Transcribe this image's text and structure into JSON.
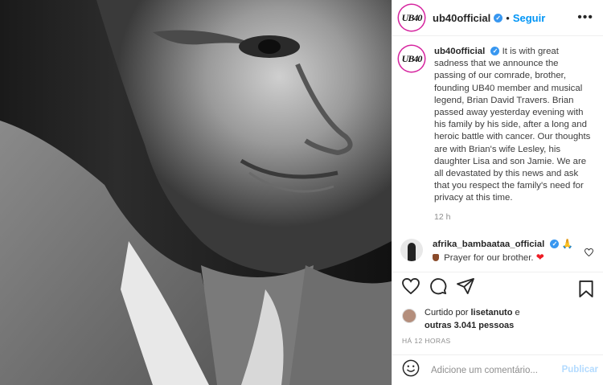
{
  "post": {
    "username": "ub40official",
    "avatar_text": "UB40",
    "follow_label": "Seguir",
    "dot": "•",
    "more_label": "•••",
    "caption": "It is with great sadness that we announce the passing of our comrade, brother, founding UB40 member and musical legend, Brian David Travers. Brian passed away yesterday evening with his family by his side, after a long and heroic battle with cancer. Our thoughts are with Brian's wife Lesley, his daughter Lisa and son Jamie. We are all devastated by this news and ask that you respect the family's need for privacy at this time.",
    "caption_time": "12 h"
  },
  "comment": {
    "username": "afrika_bambaataa_official",
    "text": "Prayer for our brother.",
    "heart": "❤"
  },
  "likes": {
    "prefix": "Curtido por",
    "user": "lisetanuto",
    "mid": "e",
    "others": "outras 3.041 pessoas"
  },
  "timestamp": "HÁ 12 HORAS",
  "add_comment": {
    "placeholder": "Adicione um comentário...",
    "publish_label": "Publicar"
  },
  "icons": {
    "like": "heart-icon",
    "comment": "comment-icon",
    "share": "share-icon",
    "save": "bookmark-icon",
    "emoji": "emoji-icon"
  },
  "colors": {
    "link_blue": "#0095f6",
    "verified_blue": "#3897f0",
    "publish_disabled": "#b3dbff",
    "border": "#efefef"
  }
}
